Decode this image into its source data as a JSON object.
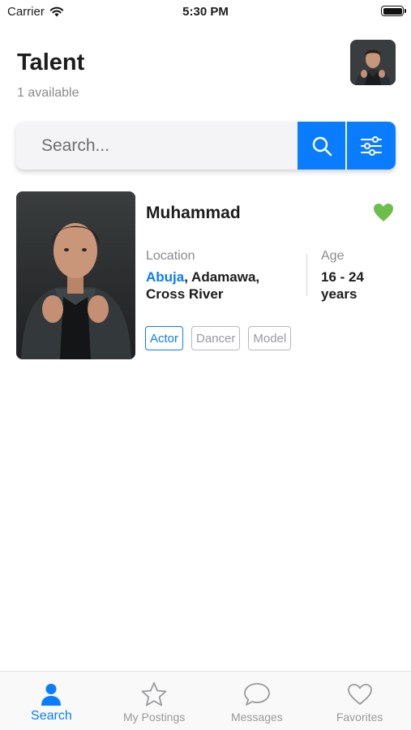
{
  "status_bar": {
    "carrier": "Carrier",
    "time": "5:30 PM",
    "battery_level": 1.0
  },
  "header": {
    "title": "Talent",
    "subtitle": "1 available",
    "avatar_icon": "user-avatar"
  },
  "search": {
    "placeholder": "Search...",
    "value": "",
    "search_icon": "search-icon",
    "filter_icon": "sliders-icon"
  },
  "talents": [
    {
      "name": "Muhammad",
      "favorited": true,
      "location_label": "Location",
      "location_city": "Abuja",
      "location_rest": ", Adamawa, Cross River",
      "age_label": "Age",
      "age_value": "16 - 24 years",
      "tags": [
        {
          "label": "Actor",
          "selected": true
        },
        {
          "label": "Dancer",
          "selected": false
        },
        {
          "label": "Model",
          "selected": false
        }
      ]
    }
  ],
  "tab_bar": {
    "items": [
      {
        "label": "Search",
        "icon": "person-icon",
        "active": true
      },
      {
        "label": "My Postings",
        "icon": "star-icon",
        "active": false
      },
      {
        "label": "Messages",
        "icon": "chat-bubble-icon",
        "active": false
      },
      {
        "label": "Favorites",
        "icon": "heart-icon",
        "active": false
      }
    ]
  },
  "colors": {
    "accent": "#0a7cff",
    "favorite": "#6cc04a",
    "muted": "#8a8a8e"
  }
}
